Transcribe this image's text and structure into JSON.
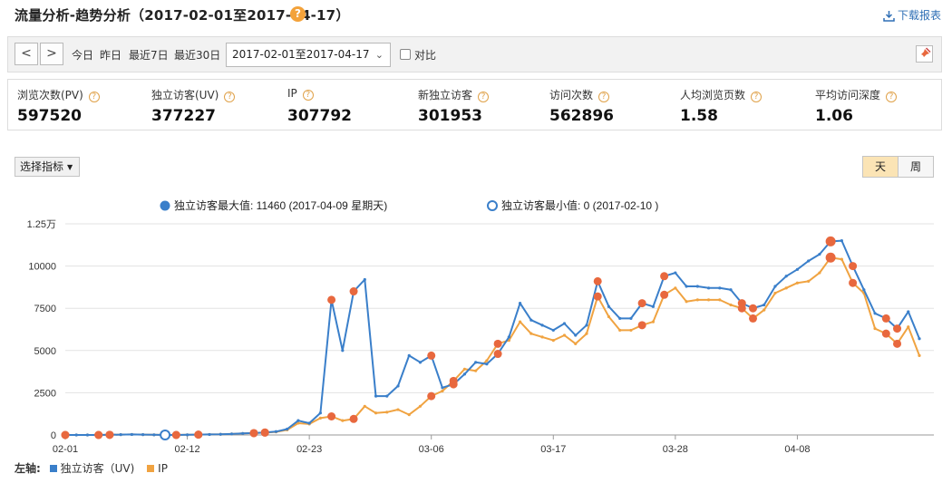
{
  "header": {
    "title": "流量分析-趋势分析（2017-02-01至2017-04-17）",
    "help_glyph": "?",
    "download_label": "下载报表"
  },
  "toolbar": {
    "prev_glyph": "<",
    "next_glyph": ">",
    "quick_ranges": [
      "今日",
      "昨日",
      "最近7日",
      "最近30日"
    ],
    "date_range_value": "2017-02-01至2017-04-17",
    "compare_label": "对比",
    "compare_checked": false
  },
  "metrics": [
    {
      "label": "浏览次数(PV)",
      "value": "597520"
    },
    {
      "label": "独立访客(UV)",
      "value": "377227"
    },
    {
      "label": "IP",
      "value": "307792"
    },
    {
      "label": "新独立访客",
      "value": "301953"
    },
    {
      "label": "访问次数",
      "value": "562896"
    },
    {
      "label": "人均浏览页数",
      "value": "1.58"
    },
    {
      "label": "平均访问深度",
      "value": "1.06"
    }
  ],
  "controls": {
    "select_metric_label": "选择指标",
    "granularity": [
      "天",
      "周"
    ],
    "granularity_selected": "天"
  },
  "colors": {
    "uv": "#3a7fca",
    "ip": "#f0a341",
    "marker": "#e8683e"
  },
  "chart_data": {
    "type": "line",
    "annotations": {
      "max_label": "独立访客最大值: 11460 (2017-04-09 星期天)",
      "min_label": "独立访客最小值: 0 (2017-02-10 )"
    },
    "x_tick_labels": [
      "02-01",
      "02-12",
      "02-23",
      "03-06",
      "03-17",
      "03-28",
      "04-08"
    ],
    "x_tick_index": [
      0,
      11,
      22,
      33,
      44,
      55,
      66
    ],
    "y_tick_labels": [
      "0",
      "2500",
      "5000",
      "7500",
      "10000",
      "1.25万"
    ],
    "ylim": [
      0,
      12500
    ],
    "axis_prefix": "左轴:",
    "series": [
      {
        "name": "独立访客（UV)",
        "key": "uv",
        "values": [
          0,
          0,
          0,
          0,
          10,
          20,
          30,
          20,
          10,
          0,
          0,
          10,
          20,
          30,
          40,
          60,
          90,
          110,
          150,
          200,
          350,
          850,
          700,
          1300,
          8000,
          5000,
          8500,
          9200,
          2300,
          2300,
          2900,
          4700,
          4300,
          4700,
          2800,
          3000,
          3600,
          4300,
          4200,
          4800,
          5800,
          7800,
          6800,
          6500,
          6200,
          6600,
          5900,
          6500,
          9100,
          7600,
          6900,
          6900,
          7800,
          7600,
          9400,
          9600,
          8800,
          8800,
          8700,
          8700,
          8600,
          7800,
          7500,
          7700,
          8800,
          9400,
          9800,
          10300,
          10700,
          11460,
          11500,
          10000,
          8600,
          7200,
          6900,
          6300,
          7300,
          5700
        ]
      },
      {
        "name": "IP",
        "key": "ip",
        "values": [
          0,
          0,
          0,
          0,
          10,
          20,
          30,
          20,
          10,
          0,
          0,
          10,
          20,
          30,
          40,
          60,
          90,
          110,
          140,
          180,
          300,
          700,
          650,
          1000,
          1100,
          850,
          950,
          1700,
          1300,
          1350,
          1500,
          1200,
          1700,
          2300,
          2600,
          3200,
          3900,
          3800,
          4400,
          5400,
          5600,
          6700,
          6000,
          5800,
          5600,
          5900,
          5400,
          6000,
          8200,
          7000,
          6200,
          6200,
          6500,
          6700,
          8300,
          8700,
          7900,
          8000,
          8000,
          8000,
          7700,
          7500,
          6900,
          7400,
          8400,
          8700,
          9000,
          9100,
          9600,
          10500,
          10400,
          9000,
          8400,
          6300,
          6000,
          5400,
          6400,
          4700
        ]
      }
    ],
    "uv_markers_index": [
      0,
      3,
      4,
      9,
      10,
      12,
      17,
      18,
      24,
      26,
      33,
      35,
      39,
      48,
      52,
      54,
      61,
      62,
      69,
      71,
      74,
      75
    ],
    "ip_markers_index": [
      0,
      3,
      4,
      9,
      10,
      12,
      17,
      18,
      24,
      26,
      33,
      35,
      39,
      48,
      52,
      54,
      61,
      62,
      69,
      71,
      74,
      75
    ],
    "max_marker_index": 69,
    "min_marker_index": 9
  }
}
